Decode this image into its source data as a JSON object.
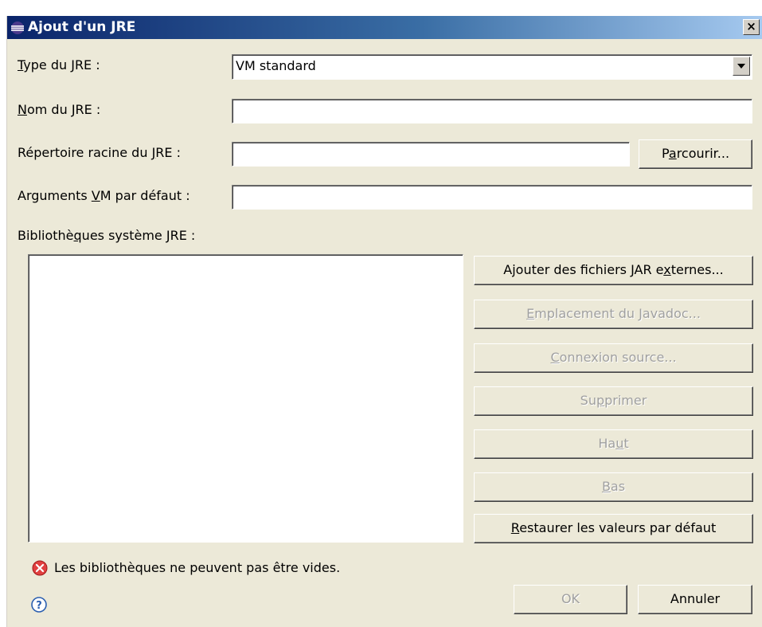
{
  "window": {
    "title": "Ajout d'un JRE",
    "close_label": "×"
  },
  "form": {
    "type_label_u": "T",
    "type_label_rest": "ype du JRE :",
    "type_value": "VM standard",
    "name_label_u": "N",
    "name_label_rest": "om du JRE :",
    "name_value": "",
    "home_label_a": "Répertoire racine du ",
    "home_label_u": "J",
    "home_label_b": "RE :",
    "home_value": "",
    "browse_a": "P",
    "browse_u": "a",
    "browse_b": "rcourir...",
    "args_label_a": "Arguments ",
    "args_label_u": "V",
    "args_label_b": "M par défaut :",
    "args_value": "",
    "libs_label_a": "Bibliothè",
    "libs_label_u": "q",
    "libs_label_b": "ues système JRE :"
  },
  "buttons": {
    "add_external_a": "Ajouter des fichiers JAR e",
    "add_external_u": "x",
    "add_external_b": "ternes...",
    "javadoc_u": "E",
    "javadoc_b": "mplacement du Javadoc...",
    "source_u": "C",
    "source_b": "onnexion source...",
    "remove_a": "Su",
    "remove_u": "p",
    "remove_b": "primer",
    "up_a": "Ha",
    "up_u": "u",
    "up_b": "t",
    "down_u": "B",
    "down_b": "as",
    "restore_u": "R",
    "restore_b": "estaurer les valeurs par défaut",
    "ok": "OK",
    "cancel": "Annuler"
  },
  "status": {
    "error_message": "Les bibliothèques ne peuvent pas être vides.",
    "error_icon": "error-icon",
    "help_icon": "help-icon"
  },
  "colors": {
    "title_gradient_start": "#0a246a",
    "title_gradient_end": "#a6caf0",
    "dialog_bg": "#ece9d8",
    "error_red": "#e04040"
  }
}
